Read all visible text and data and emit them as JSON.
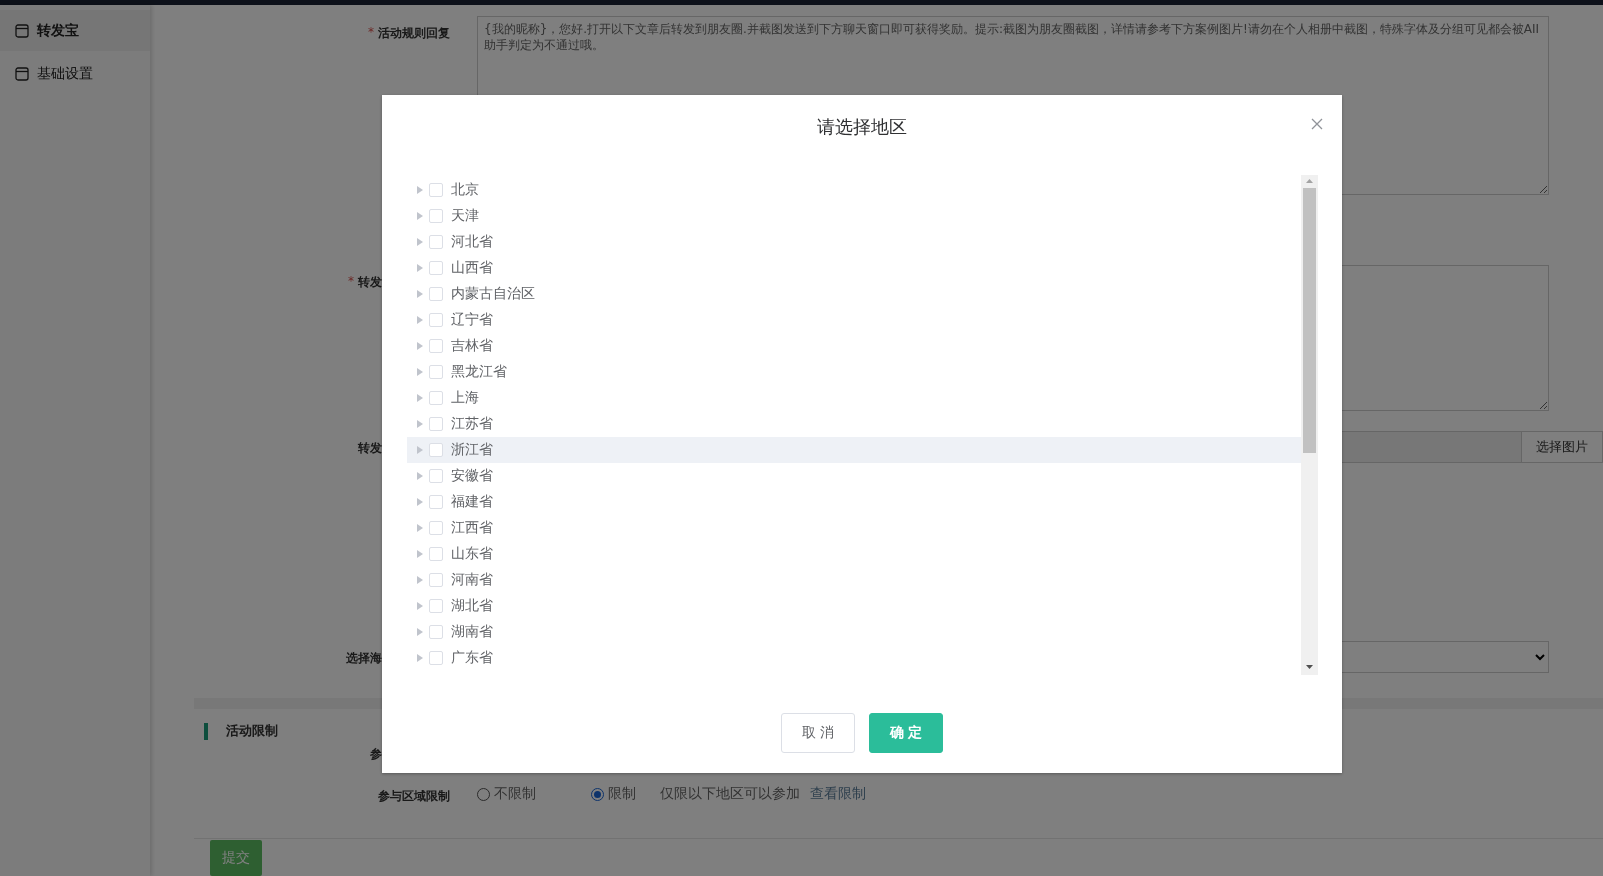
{
  "sidebar": {
    "items": [
      {
        "label": "转发宝",
        "selected": true
      },
      {
        "label": "基础设置",
        "selected": false
      }
    ]
  },
  "form": {
    "fields": [
      {
        "kind": "textarea",
        "label": "活动规则回复",
        "required_mark": "*",
        "value": "{我的昵称}，您好.打开以下文章后转发到朋友圈.并截图发送到下方聊天窗口即可获得奖励。提示:截图为朋友圈截图，详情请参考下方案例图片!请勿在个人相册中截图，特殊字体及分组可见都会被AII助手判定为不通过哦。"
      },
      {
        "kind": "textarea",
        "label": "转发",
        "required_mark": "*"
      },
      {
        "kind": "image",
        "label": "转发",
        "button": "选择图片"
      },
      {
        "kind": "select",
        "label": "选择海"
      }
    ]
  },
  "limits": {
    "title": "活动限制",
    "rows": [
      {
        "kind": "blank",
        "label": "参"
      },
      {
        "kind": "radio",
        "label": "参与区域限制",
        "options": [
          {
            "label": "不限制",
            "selected": false
          },
          {
            "label": "限制",
            "selected": true
          }
        ],
        "note": "仅限以下地区可以参加",
        "link": "查看限制"
      }
    ]
  },
  "submit": "提交",
  "dialog": {
    "title": "请选择地区",
    "regions": [
      {
        "label": "北京",
        "checked": false,
        "hovered": false
      },
      {
        "label": "天津",
        "checked": false,
        "hovered": false
      },
      {
        "label": "河北省",
        "checked": false,
        "hovered": false
      },
      {
        "label": "山西省",
        "checked": false,
        "hovered": false
      },
      {
        "label": "内蒙古自治区",
        "checked": false,
        "hovered": false
      },
      {
        "label": "辽宁省",
        "checked": false,
        "hovered": false
      },
      {
        "label": "吉林省",
        "checked": false,
        "hovered": false
      },
      {
        "label": "黑龙江省",
        "checked": false,
        "hovered": false
      },
      {
        "label": "上海",
        "checked": false,
        "hovered": false
      },
      {
        "label": "江苏省",
        "checked": false,
        "hovered": false
      },
      {
        "label": "浙江省",
        "checked": false,
        "hovered": true
      },
      {
        "label": "安徽省",
        "checked": false,
        "hovered": false
      },
      {
        "label": "福建省",
        "checked": false,
        "hovered": false
      },
      {
        "label": "江西省",
        "checked": false,
        "hovered": false
      },
      {
        "label": "山东省",
        "checked": false,
        "hovered": false
      },
      {
        "label": "河南省",
        "checked": false,
        "hovered": false
      },
      {
        "label": "湖北省",
        "checked": false,
        "hovered": false
      },
      {
        "label": "湖南省",
        "checked": false,
        "hovered": false
      },
      {
        "label": "广东省",
        "checked": false,
        "hovered": false
      }
    ],
    "cancel": "取 消",
    "confirm": "确 定"
  }
}
